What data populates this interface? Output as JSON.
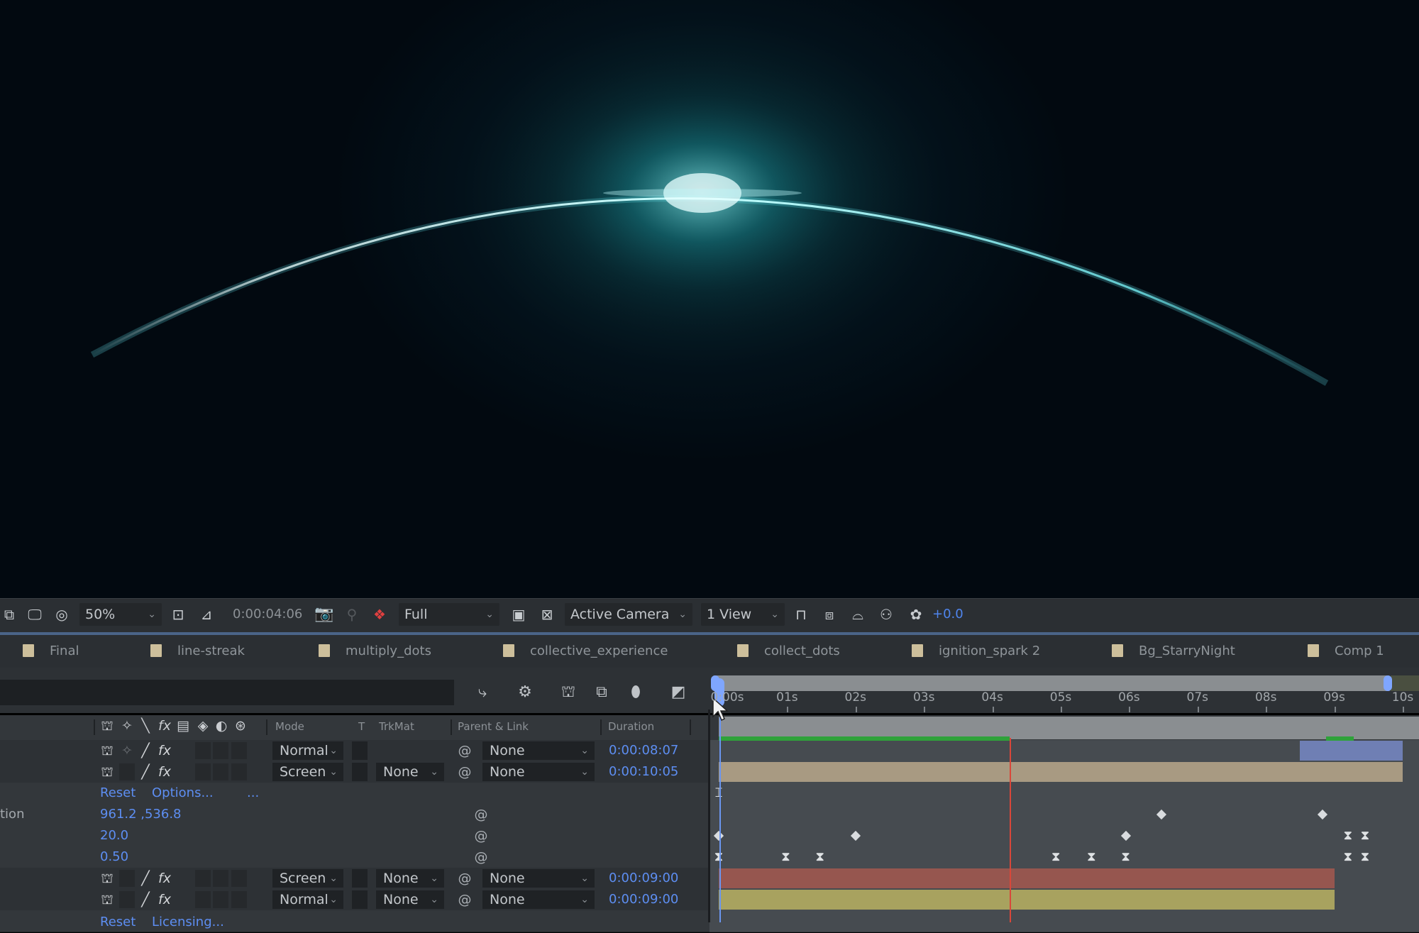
{
  "viewer": {
    "description": "glowing cyan arc horizon with lens flare on dark background",
    "accent_color": "#5fe0e6"
  },
  "toolbar": {
    "zoom_value": "50%",
    "timecode": "0:00:04:06",
    "resolution": "Full",
    "camera": "Active Camera",
    "view_layout": "1 View",
    "exposure": "+0.0",
    "icons": [
      "always-preview-icon",
      "monitor-icon",
      "vr-glasses-icon",
      "region-of-interest-icon",
      "transparency-grid-icon",
      "snapshot-camera-icon",
      "show-snapshot-icon",
      "color-channels-icon",
      "fast-preview-icon",
      "toggle-mask-icon",
      "3d-view-icon",
      "flowchart-icon",
      "reset-exposure-icon"
    ]
  },
  "comp_tabs": [
    {
      "label": "Final",
      "color": "#cdbf9b"
    },
    {
      "label": "line-streak",
      "color": "#cdbf9b"
    },
    {
      "label": "multiply_dots",
      "color": "#cdbf9b"
    },
    {
      "label": "collective_experience",
      "color": "#cdbf9b"
    },
    {
      "label": "collect_dots",
      "color": "#cdbf9b"
    },
    {
      "label": "ignition_spark 2",
      "color": "#cdbf9b"
    },
    {
      "label": "Bg_StarryNight",
      "color": "#cdbf9b"
    },
    {
      "label": "Comp 1",
      "color": "#cdbf9b"
    }
  ],
  "timeline": {
    "search_placeholder": "",
    "ruler_labels": [
      "0:00s",
      "01s",
      "02s",
      "03s",
      "04s",
      "05s",
      "06s",
      "07s",
      "08s",
      "09s",
      "10s"
    ],
    "duration_seconds": 10,
    "current_time_seconds": 0,
    "marker_time_seconds": 4.25,
    "headers": {
      "mode": "Mode",
      "t": "T",
      "trkmat": "TrkMat",
      "parent": "Parent & Link",
      "duration": "Duration"
    },
    "layers": [
      {
        "mode": "Normal",
        "trkmat": "",
        "parent": "None",
        "duration": "0:00:08:07",
        "bar_color": "#6f7fb4",
        "bar_start": 8.5,
        "bar_end": 10,
        "work_green_end": 4.25
      },
      {
        "mode": "Screen",
        "trkmat": "None",
        "parent": "None",
        "duration": "0:00:10:05",
        "bar_color": "#a89a82",
        "bar_start": 0,
        "bar_end": 10
      }
    ],
    "effect_row": {
      "reset": "Reset",
      "options": "Options...",
      "extra": "..."
    },
    "properties": [
      {
        "name": "Position",
        "value": "961.2 ,536.8",
        "keyframes": [
          6.47,
          8.83
        ],
        "kf_type": "diamond"
      },
      {
        "name": "",
        "value": "20.0",
        "keyframes": [
          0,
          2.0,
          5.95
        ],
        "kf_type": "diamond",
        "hold_keyframes": [
          9.2,
          9.45
        ]
      },
      {
        "name": "",
        "value": "0.50",
        "keyframes": [],
        "kf_type": "hold",
        "hold_keyframes": [
          0,
          0.98,
          1.48,
          4.93,
          5.45,
          5.95,
          9.2,
          9.45
        ]
      }
    ],
    "layers_bottom": [
      {
        "mode": "Screen",
        "trkmat": "None",
        "parent": "None",
        "duration": "0:00:09:00",
        "bar_color": "#96564f",
        "bar_start": 0,
        "bar_end": 9
      },
      {
        "mode": "Normal",
        "trkmat": "None",
        "parent": "None",
        "duration": "0:00:09:00",
        "bar_color": "#a8a25f",
        "bar_start": 0,
        "bar_end": 9
      }
    ],
    "bottom_row": {
      "reset": "Reset",
      "licensing": "Licensing..."
    },
    "position_prop_label": "tion"
  }
}
